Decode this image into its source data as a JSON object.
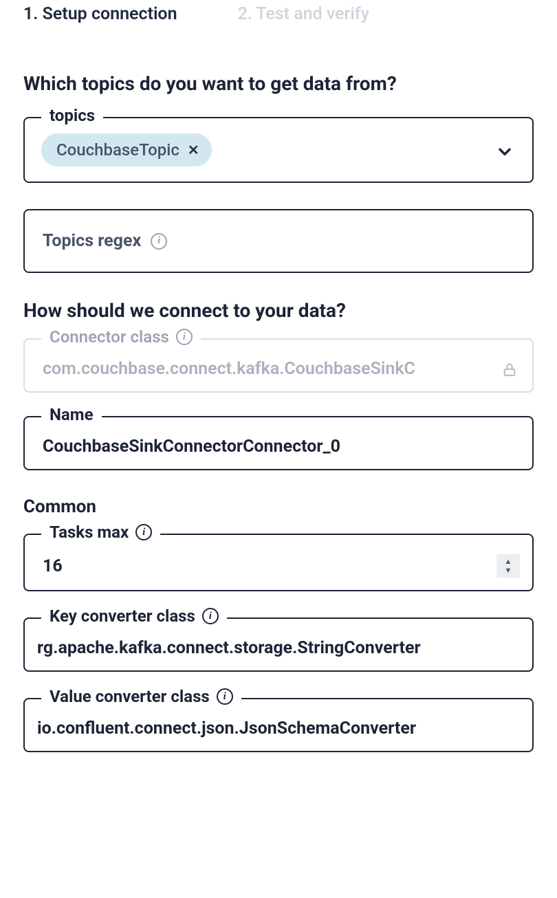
{
  "steps": {
    "s1": "1. Setup connection",
    "s2": "2. Test and verify"
  },
  "sections": {
    "topics_q": "Which topics do you want to get data from?",
    "connect_q": "How should we connect to your data?",
    "common": "Common"
  },
  "fields": {
    "topics": {
      "legend": "topics",
      "chips": [
        {
          "label": "CouchbaseTopic"
        }
      ]
    },
    "topics_regex": {
      "label": "Topics regex"
    },
    "connector_class": {
      "legend": "Connector class",
      "value": "com.couchbase.connect.kafka.CouchbaseSinkC"
    },
    "name": {
      "legend": "Name",
      "value": "CouchbaseSinkConnectorConnector_0"
    },
    "tasks_max": {
      "legend": "Tasks max",
      "value": "16"
    },
    "key_converter": {
      "legend": "Key converter class",
      "value": "rg.apache.kafka.connect.storage.StringConverter"
    },
    "value_converter": {
      "legend": "Value converter class",
      "value": "io.confluent.connect.json.JsonSchemaConverter"
    }
  }
}
